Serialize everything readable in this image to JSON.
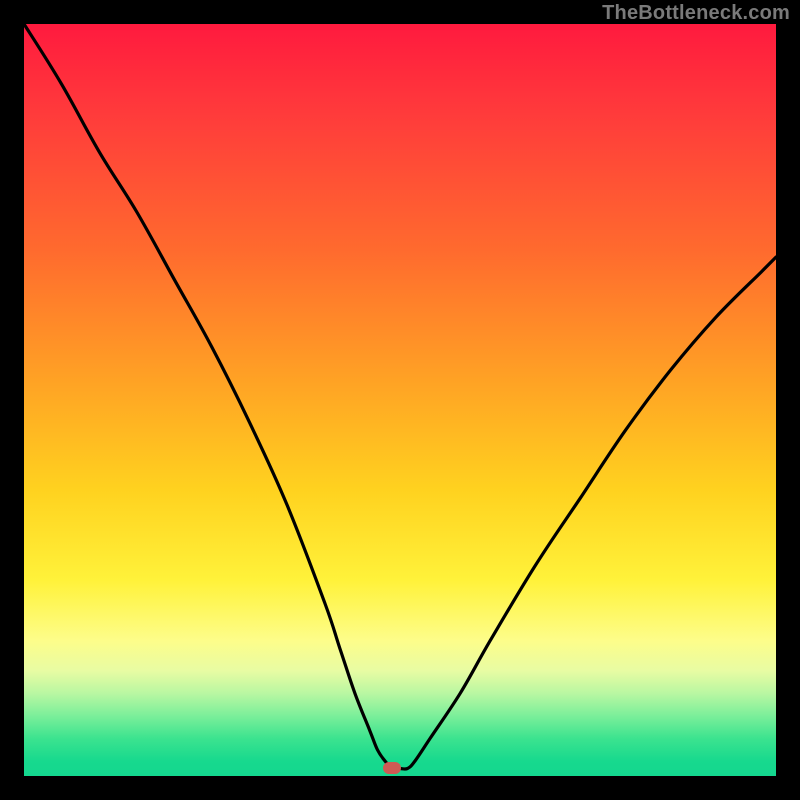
{
  "watermark": "TheBottleneck.com",
  "colors": {
    "frame_bg": "#000000",
    "gradient_top": "#ff1a3e",
    "gradient_bottom": "#14d78f",
    "curve_stroke": "#000000",
    "marker_fill": "#cd5a54",
    "watermark_text": "#7a7a7a"
  },
  "chart_data": {
    "type": "line",
    "title": "",
    "xlabel": "",
    "ylabel": "",
    "xlim": [
      0,
      100
    ],
    "ylim": [
      0,
      100
    ],
    "grid": false,
    "legend": false,
    "series": [
      {
        "name": "bottleneck-curve",
        "x": [
          0,
          5,
          10,
          15,
          20,
          25,
          30,
          35,
          40,
          42,
          44,
          46,
          47,
          48,
          49,
          50,
          51,
          52,
          54,
          58,
          62,
          68,
          74,
          80,
          86,
          92,
          98,
          100
        ],
        "y": [
          100,
          92,
          83,
          75,
          66,
          57,
          47,
          36,
          23,
          17,
          11,
          6,
          3.5,
          2,
          1,
          1,
          1,
          2,
          5,
          11,
          18,
          28,
          37,
          46,
          54,
          61,
          67,
          69
        ]
      }
    ],
    "annotations": [
      {
        "name": "min-marker",
        "x": 49,
        "y": 1
      }
    ],
    "background_gradient": {
      "direction": "top-to-bottom",
      "stops": [
        {
          "pos": 0.0,
          "color": "#ff1a3e"
        },
        {
          "pos": 0.3,
          "color": "#ff6a2e"
        },
        {
          "pos": 0.62,
          "color": "#ffd21f"
        },
        {
          "pos": 0.82,
          "color": "#fdfd8a"
        },
        {
          "pos": 1.0,
          "color": "#14d78f"
        }
      ]
    }
  }
}
